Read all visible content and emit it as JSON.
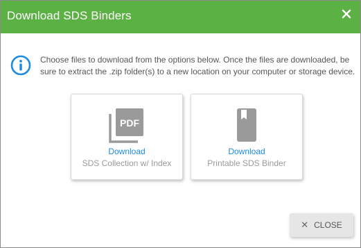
{
  "dialog": {
    "title": "Download SDS Binders",
    "header_color": "#5cb145",
    "close_icon": "close-icon"
  },
  "info": {
    "icon": "info-circle-icon",
    "color": "#1a8be0",
    "message": "Choose files to download from the options below. Once the files are downloaded, be sure to extract the .zip folder(s) to a new location on your computer or storage device."
  },
  "options": [
    {
      "icon": "pdf-collection-icon",
      "link_label": "Download",
      "sub_label": "SDS Collection w/ Index"
    },
    {
      "icon": "bookmark-book-icon",
      "link_label": "Download",
      "sub_label": "Printable SDS Binder"
    }
  ],
  "footer": {
    "close_icon": "close-icon",
    "close_label": "CLOSE"
  }
}
